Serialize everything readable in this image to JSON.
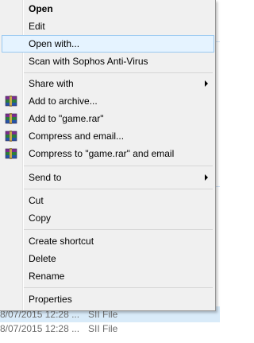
{
  "background_rows": [
    {
      "date": "8/07/2015 12:28 ...",
      "type": "SII File",
      "selected": true
    },
    {
      "date": "8/07/2015 12:28 ...",
      "type": "SII File",
      "selected": false
    }
  ],
  "menu": {
    "open": "Open",
    "edit": "Edit",
    "open_with": "Open with...",
    "scan": "Scan with Sophos Anti-Virus",
    "share_with": "Share with",
    "add_archive": "Add to archive...",
    "add_rar": "Add to \"game.rar\"",
    "compress_email": "Compress and email...",
    "compress_rar_email": "Compress to \"game.rar\" and email",
    "send_to": "Send to",
    "cut": "Cut",
    "copy": "Copy",
    "create_shortcut": "Create shortcut",
    "delete": "Delete",
    "rename": "Rename",
    "properties": "Properties"
  },
  "icons": {
    "winrar": "winrar-books-icon",
    "submenu": "chevron-right-icon"
  },
  "colors": {
    "menu_bg": "#f0f0f0",
    "hover_bg": "#e5f3ff",
    "hover_border": "#99c8f0",
    "row_selected": "#d9ebf9"
  }
}
